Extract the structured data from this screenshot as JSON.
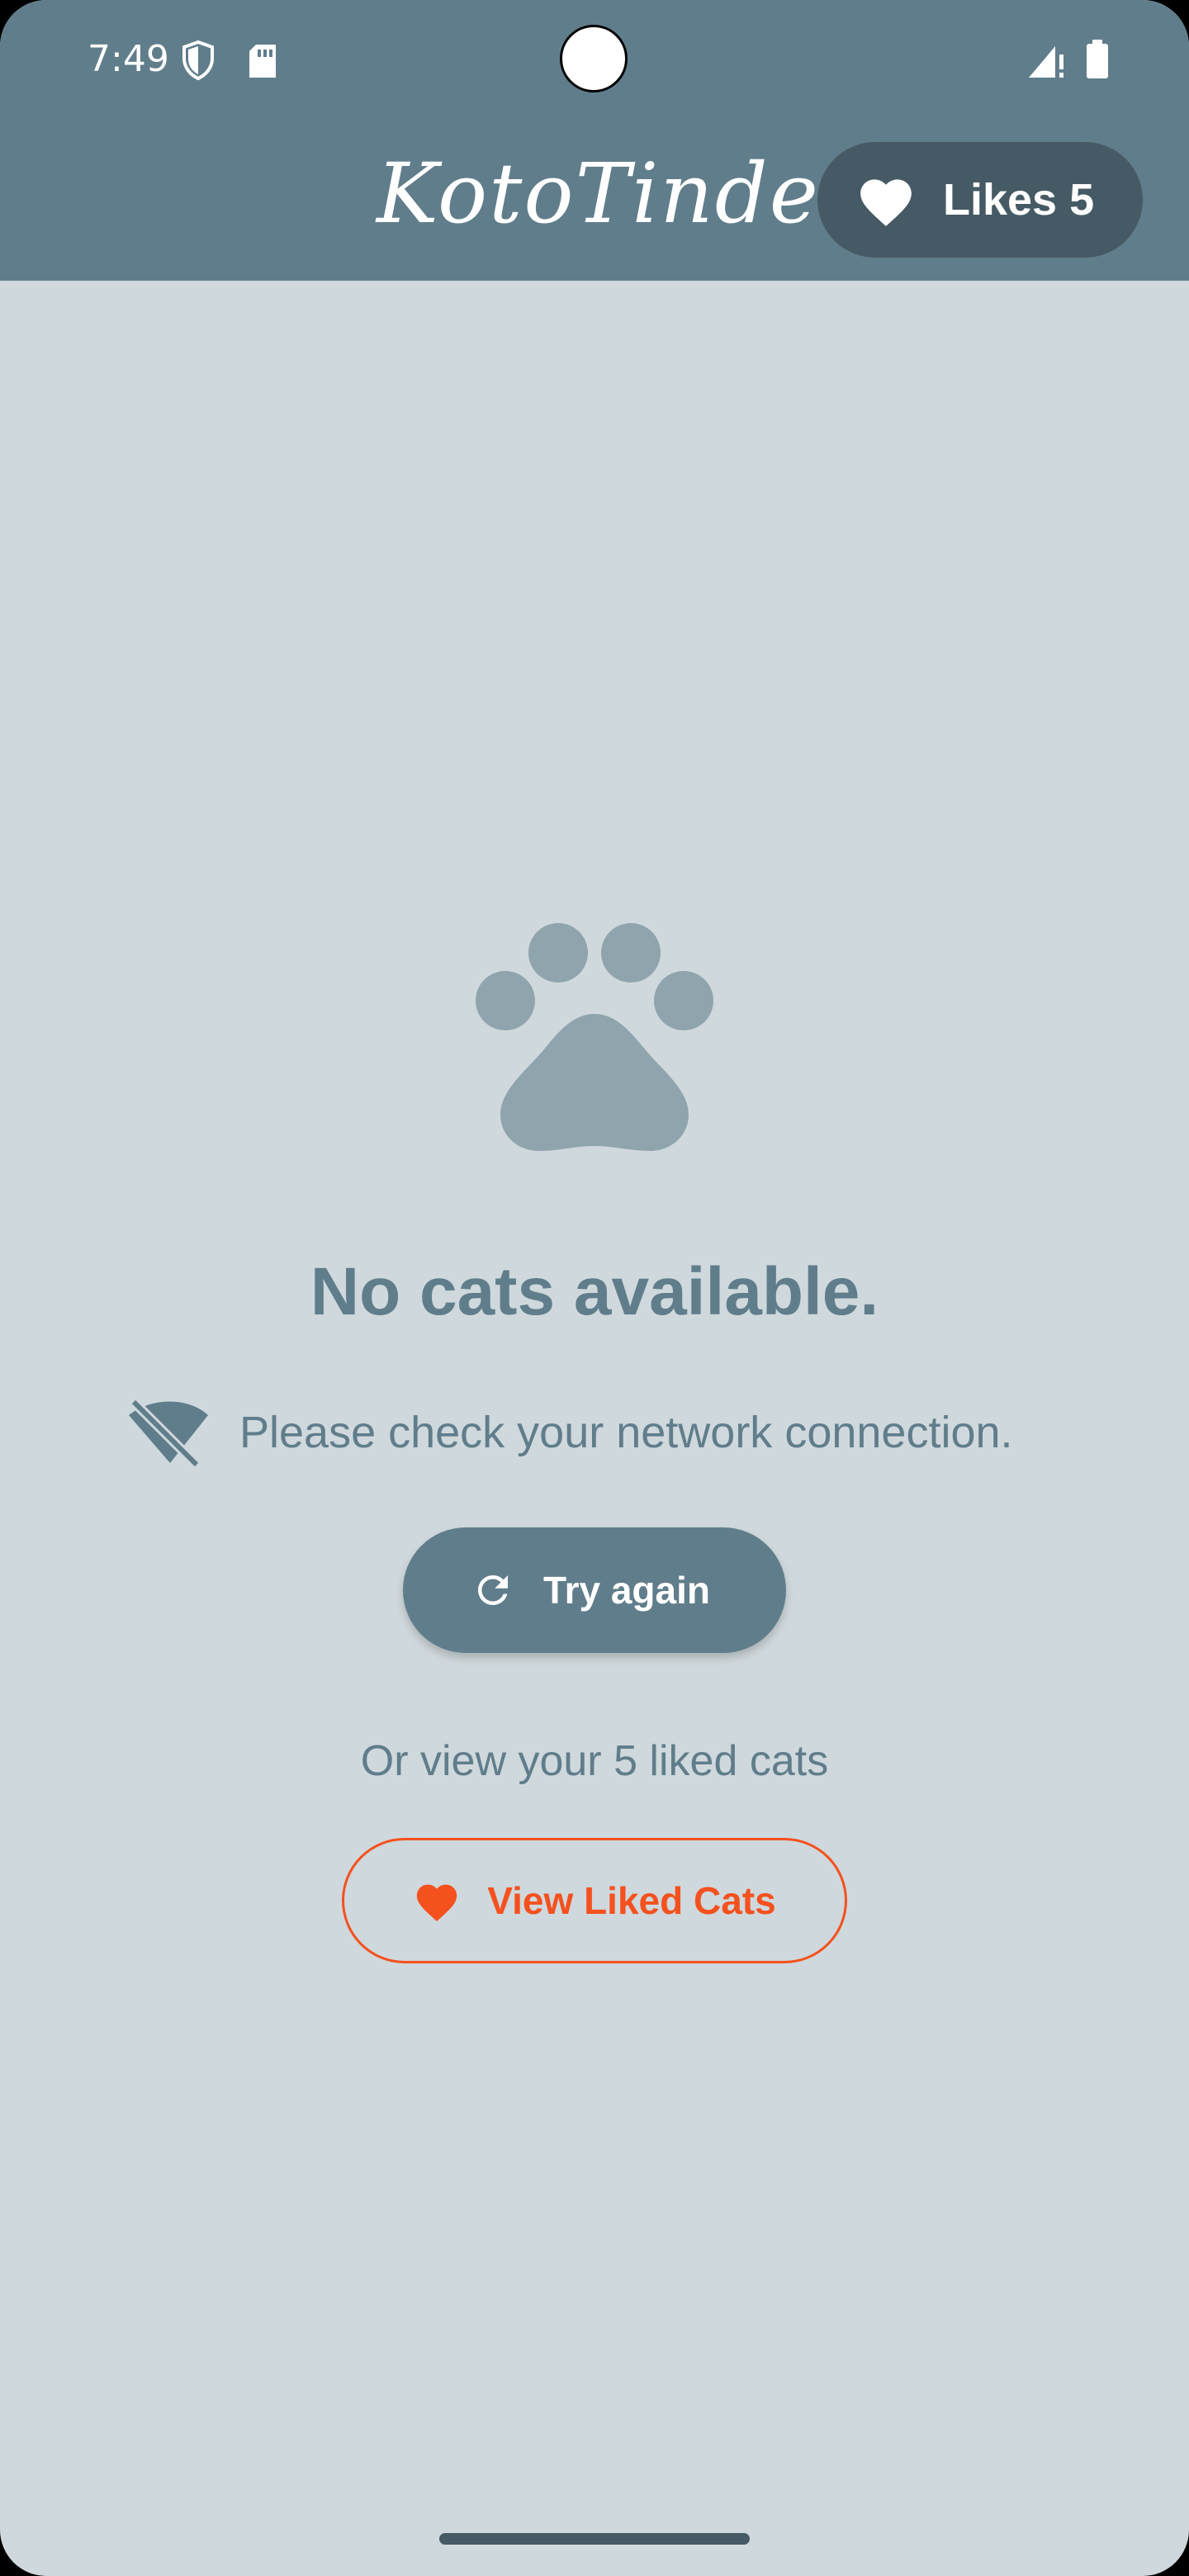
{
  "status_bar": {
    "time": "7:49",
    "icons": [
      "shield-icon",
      "sd-card-icon",
      "signal-icon",
      "battery-icon"
    ]
  },
  "app_bar": {
    "title": "KotoTinder",
    "likes_label": "Likes 5",
    "likes_icon": "heart-icon"
  },
  "empty_state": {
    "icon": "paw-icon",
    "headline": "No cats available.",
    "network_icon": "wifi-off-icon",
    "network_message": "Please check your network connection.",
    "retry_label": "Try again",
    "retry_icon": "refresh-icon",
    "or_text": "Or view your 5 liked cats",
    "view_liked_label": "View Liked Cats",
    "view_liked_icon": "heart-icon"
  },
  "colors": {
    "app_bar": "#607d8b",
    "background": "#cfd8dc",
    "pill": "#455a64",
    "paw": "#90a4ae",
    "accent": "#f4511e"
  }
}
